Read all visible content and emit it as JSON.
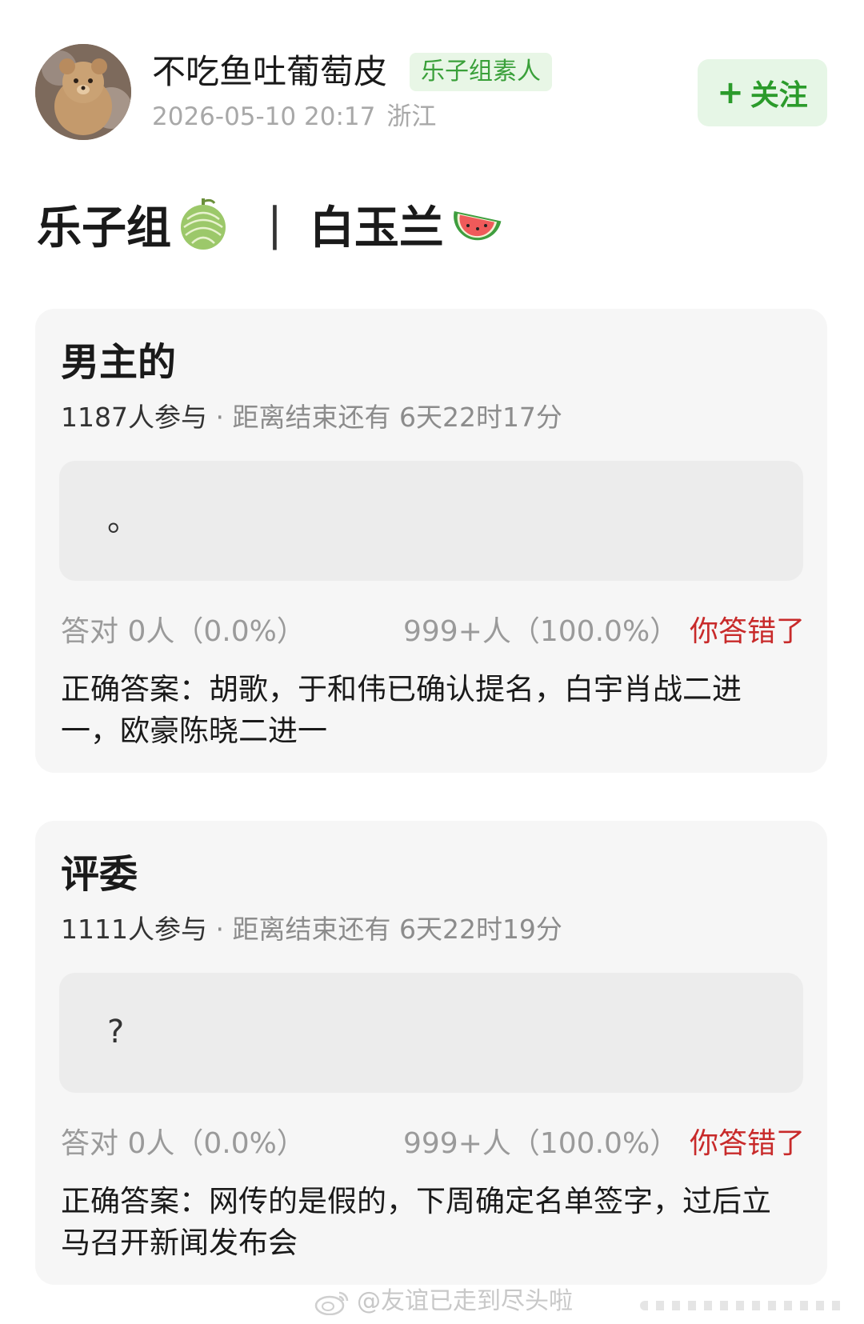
{
  "header": {
    "username": "不吃鱼吐葡萄皮",
    "badge": "乐子组素人",
    "datetime": "2026-05-10 20:17",
    "location": "浙江",
    "follow_label": "关注",
    "follow_plus": "+"
  },
  "post": {
    "title_left": "乐子组",
    "separator": "|",
    "title_right": "白玉兰"
  },
  "quizzes": [
    {
      "title": "男主的",
      "participants": "1187人参与",
      "remaining": "· 距离结束还有 6天22时17分",
      "option_text": "。",
      "correct_stats": "答对  0人（0.0%）",
      "wrong_stats": "999+人（100.0%）",
      "verdict": "你答错了",
      "answer": "正确答案：胡歌，于和伟已确认提名，白宇肖战二进一，欧豪陈晓二进一"
    },
    {
      "title": "评委",
      "participants": "1111人参与",
      "remaining": "· 距离结束还有 6天22时19分",
      "option_text": "?",
      "correct_stats": "答对  0人（0.0%）",
      "wrong_stats": "999+人（100.0%）",
      "verdict": "你答错了",
      "answer": "正确答案：网传的是假的，下周确定名单签字，过后立马召开新闻发布会"
    }
  ],
  "watermark": {
    "text": "@友谊已走到尽头啦"
  },
  "colors": {
    "accent_green": "#2b9b2b",
    "wrong_red": "#c82a2a",
    "card_bg": "#f6f6f6"
  },
  "icons": {
    "follow": "plus-icon",
    "title_emoji_1": "melon-icon",
    "title_emoji_2": "watermelon-icon",
    "watermark": "weibo-logo-icon"
  }
}
